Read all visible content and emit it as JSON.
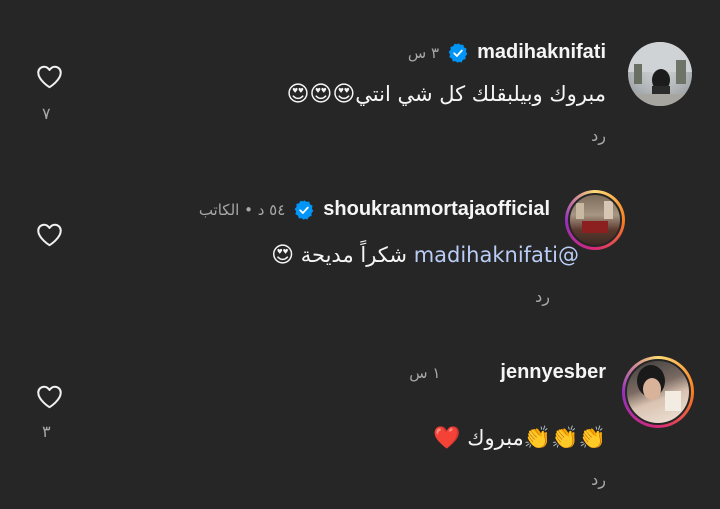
{
  "comments": [
    {
      "username": "madihaknifati",
      "time": "٣ س",
      "text": "مبروك وبيلبقلك كل شي انتي",
      "emojis": "😍😍😍",
      "reply": "رد",
      "likes": "٧",
      "verified": true,
      "has_story_ring": false
    },
    {
      "username": "shoukranmortajaofficial",
      "time": "٥٤ د • الكاتب",
      "mention": "@madihaknifati",
      "text": "شكراً مديحة",
      "emojis": "😍",
      "reply": "رد",
      "likes": "",
      "verified": true,
      "has_story_ring": true
    },
    {
      "username": "jennyesber",
      "time": "١ س",
      "text": "مبروك",
      "emojis_clap": "👏👏👏",
      "emoji_heart": "❤️",
      "reply": "رد",
      "likes": "٣",
      "verified": false,
      "has_story_ring": true
    }
  ],
  "colors": {
    "background": "#262626",
    "text_primary": "#f5f5f5",
    "text_secondary": "#a8a8a8",
    "verified_blue": "#0095f6",
    "mention_blue": "#b9cdf6"
  },
  "icons": {
    "like": "heart-outline-icon",
    "verified": "verified-badge-icon"
  }
}
